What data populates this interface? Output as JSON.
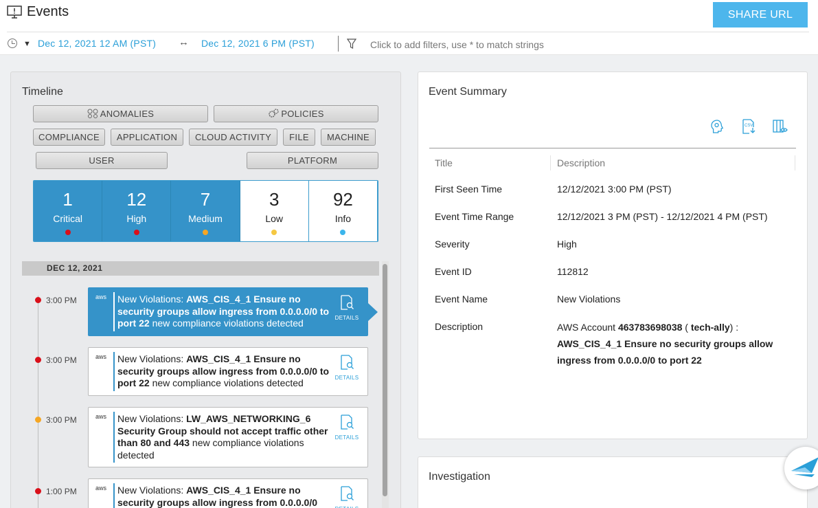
{
  "header": {
    "icon": "monitor-alert-icon",
    "title": "Events",
    "share_label": "SHARE URL"
  },
  "filter_bar": {
    "clock_icon": "clock-icon",
    "date_from": "Dec 12, 2021 12 AM (PST)",
    "range_arrow": "↔",
    "date_to": "Dec 12, 2021 6 PM (PST)",
    "filter_icon": "funnel-icon",
    "filter_placeholder": "Click to add filters, use * to match strings"
  },
  "timeline": {
    "title": "Timeline",
    "filters": {
      "anomalies": "ANOMALIES",
      "policies": "POLICIES",
      "compliance": "COMPLIANCE",
      "application": "APPLICATION",
      "cloud_activity": "CLOUD ACTIVITY",
      "file": "FILE",
      "machine": "MACHINE",
      "user": "USER",
      "platform": "PLATFORM"
    },
    "severity": [
      {
        "count": "1",
        "label": "Critical",
        "color": "#d9101a"
      },
      {
        "count": "12",
        "label": "High",
        "color": "#d9101a"
      },
      {
        "count": "7",
        "label": "Medium",
        "color": "#f5a623"
      },
      {
        "count": "3",
        "label": "Low",
        "color": "#f5c842"
      },
      {
        "count": "92",
        "label": "Info",
        "color": "#3bb5ec"
      }
    ],
    "date_header": "DEC 12, 2021",
    "details_label": "DETAILS",
    "aws_label": "aws",
    "events": [
      {
        "time": "3:00 PM",
        "dot": "#d9101a",
        "prefix": "New Violations: ",
        "bold": "AWS_CIS_4_1 Ensure no security groups allow ingress from 0.0.0.0/0 to port 22",
        "suffix": " new compliance violations detected"
      },
      {
        "time": "3:00 PM",
        "dot": "#d9101a",
        "prefix": "New Violations: ",
        "bold": "AWS_CIS_4_1 Ensure no security groups allow ingress from 0.0.0.0/0 to port 22",
        "suffix": " new compliance violations detected"
      },
      {
        "time": "3:00 PM",
        "dot": "#f5a623",
        "prefix": "New Violations: ",
        "bold": "LW_AWS_NETWORKING_6 Security Group should not accept traffic other than 80 and 443",
        "suffix": " new compliance violations detected"
      },
      {
        "time": "1:00 PM",
        "dot": "#d9101a",
        "prefix": "New Violations: ",
        "bold": "AWS_CIS_4_1 Ensure no security groups allow ingress from 0.0.0.0/0",
        "suffix": ""
      }
    ]
  },
  "summary": {
    "title": "Event Summary",
    "tools": [
      "brain-gear-icon",
      "csv-download-icon",
      "columns-view-icon"
    ],
    "col_title": "Title",
    "col_desc": "Description",
    "rows": [
      {
        "k": "First Seen Time",
        "v": "12/12/2021 3:00 PM (PST)"
      },
      {
        "k": "Event Time Range",
        "v": "12/12/2021 3 PM (PST) - 12/12/2021 4 PM (PST)"
      },
      {
        "k": "Severity",
        "v": "High"
      },
      {
        "k": "Event ID",
        "v": "112812"
      },
      {
        "k": "Event Name",
        "v": "New Violations"
      },
      {
        "k": "Description",
        "v": ""
      }
    ],
    "desc": {
      "p1": "AWS Account ",
      "account": "463783698038",
      "p2": " ( ",
      "alias": "tech-ally",
      "p3": ") :",
      "policy": "AWS_CIS_4_1 Ensure no security groups allow ingress from 0.0.0.0/0 to port 22"
    }
  },
  "investigation": {
    "title": "Investigation"
  }
}
